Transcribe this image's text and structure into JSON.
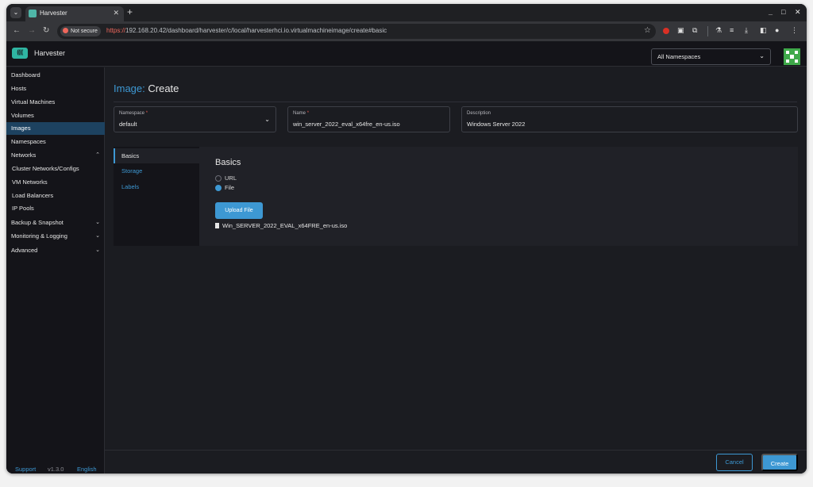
{
  "browser": {
    "tab_title": "Harvester",
    "security_label": "Not secure",
    "url_scheme": "https://",
    "url_rest": "192.168.20.42/dashboard/harvester/c/local/harvesterhci.io.virtualmachineimage/create#basic"
  },
  "header": {
    "logo_text": "((((",
    "brand": "Harvester",
    "namespace_filter": "All Namespaces"
  },
  "sidebar": {
    "items": [
      {
        "label": "Dashboard"
      },
      {
        "label": "Hosts"
      },
      {
        "label": "Virtual Machines"
      },
      {
        "label": "Volumes"
      },
      {
        "label": "Images",
        "active": true
      },
      {
        "label": "Namespaces"
      },
      {
        "label": "Networks",
        "expanded": true
      },
      {
        "label": "Cluster Networks/Configs"
      },
      {
        "label": "VM Networks"
      },
      {
        "label": "Load Balancers"
      },
      {
        "label": "IP Pools"
      },
      {
        "label": "Backup & Snapshot"
      },
      {
        "label": "Monitoring & Logging"
      },
      {
        "label": "Advanced"
      }
    ],
    "support": "Support",
    "version": "v1.3.0",
    "language": "English"
  },
  "page": {
    "title_kind": "Image:",
    "title_action": "Create"
  },
  "form": {
    "namespace": {
      "label": "Namespace",
      "required": "*",
      "value": "default"
    },
    "name": {
      "label": "Name",
      "required": "*",
      "value": "win_server_2022_eval_x64fre_en-us.iso"
    },
    "description": {
      "label": "Description",
      "value": "Windows Server 2022"
    }
  },
  "tabs": [
    {
      "label": "Basics",
      "active": true
    },
    {
      "label": "Storage"
    },
    {
      "label": "Labels"
    }
  ],
  "basics": {
    "title": "Basics",
    "options": [
      {
        "label": "URL",
        "selected": false
      },
      {
        "label": "File",
        "selected": true
      }
    ],
    "upload_label": "Upload File",
    "file_name": "Win_SERVER_2022_EVAL_x64FRE_en-us.iso"
  },
  "footer": {
    "cancel": "Cancel",
    "create": "Create"
  },
  "colors": {
    "accent": "#3d98d3",
    "brand": "#2fb5a2",
    "active_nav_bg": "#1d4260"
  }
}
